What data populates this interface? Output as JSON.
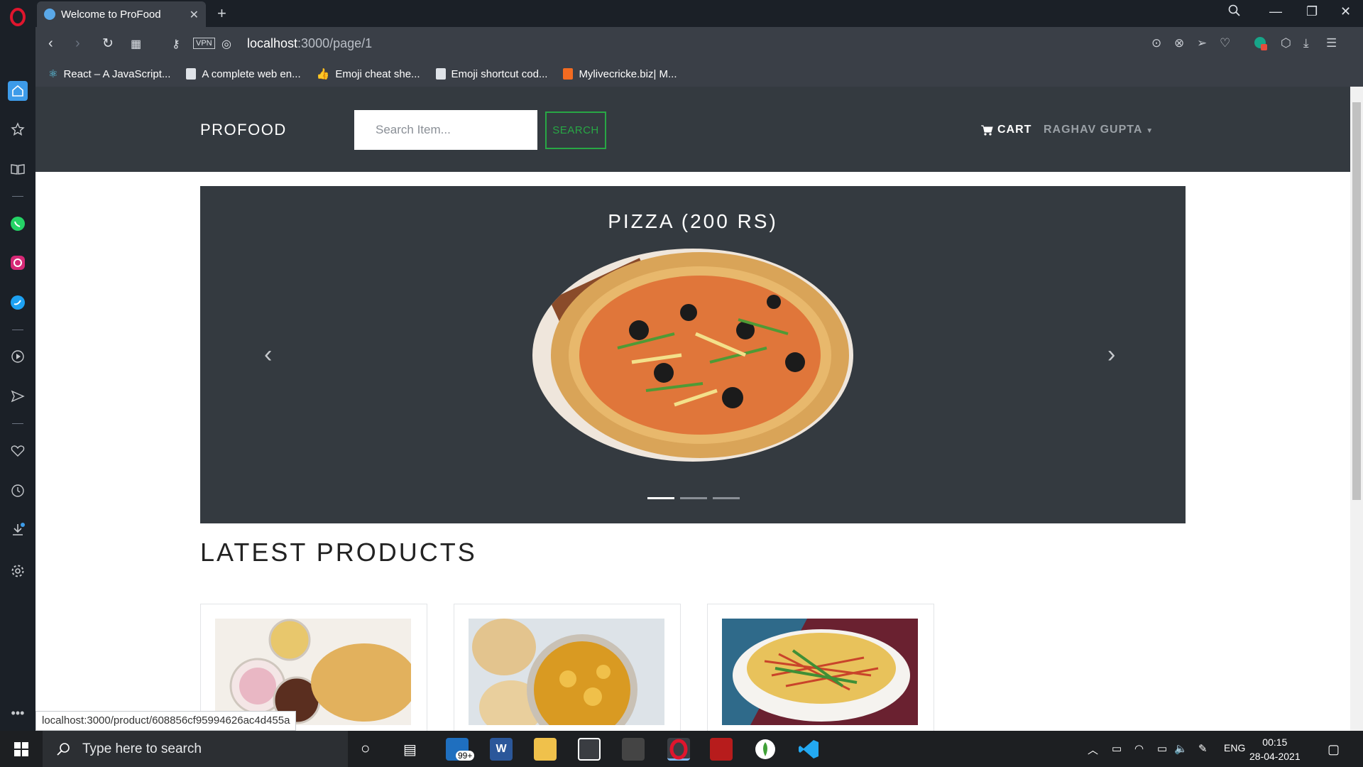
{
  "browser": {
    "tab_title": "Welcome to ProFood",
    "url_host": "localhost",
    "url_path": ":3000/page/1",
    "vpn_label": "VPN",
    "bookmarks": [
      {
        "label": "React – A JavaScript..."
      },
      {
        "label": "A complete web en..."
      },
      {
        "label": "Emoji cheat she..."
      },
      {
        "label": "Emoji shortcut cod..."
      },
      {
        "label": "Mylivecricke.biz| M..."
      }
    ],
    "status_url": "localhost:3000/product/608856cf95994626ac4d455a"
  },
  "navbar": {
    "brand": "PROFOOD",
    "search_placeholder": "Search Item...",
    "search_button": "SEARCH",
    "cart_label": "CART",
    "user_label": "RAGHAV GUPTA"
  },
  "carousel": {
    "title": "PIZZA (200 RS)",
    "prev_icon": "‹",
    "next_icon": "›"
  },
  "main": {
    "section_title": "LATEST PRODUCTS"
  },
  "taskbar": {
    "search_placeholder": "Type here to search",
    "mail_badge": "99+",
    "lang": "ENG",
    "time": "00:15",
    "date": "28-04-2021"
  },
  "colors": {
    "navbar_bg": "#343a40",
    "search_btn_accent": "#28a745",
    "browser_chrome": "#3a3f47"
  }
}
